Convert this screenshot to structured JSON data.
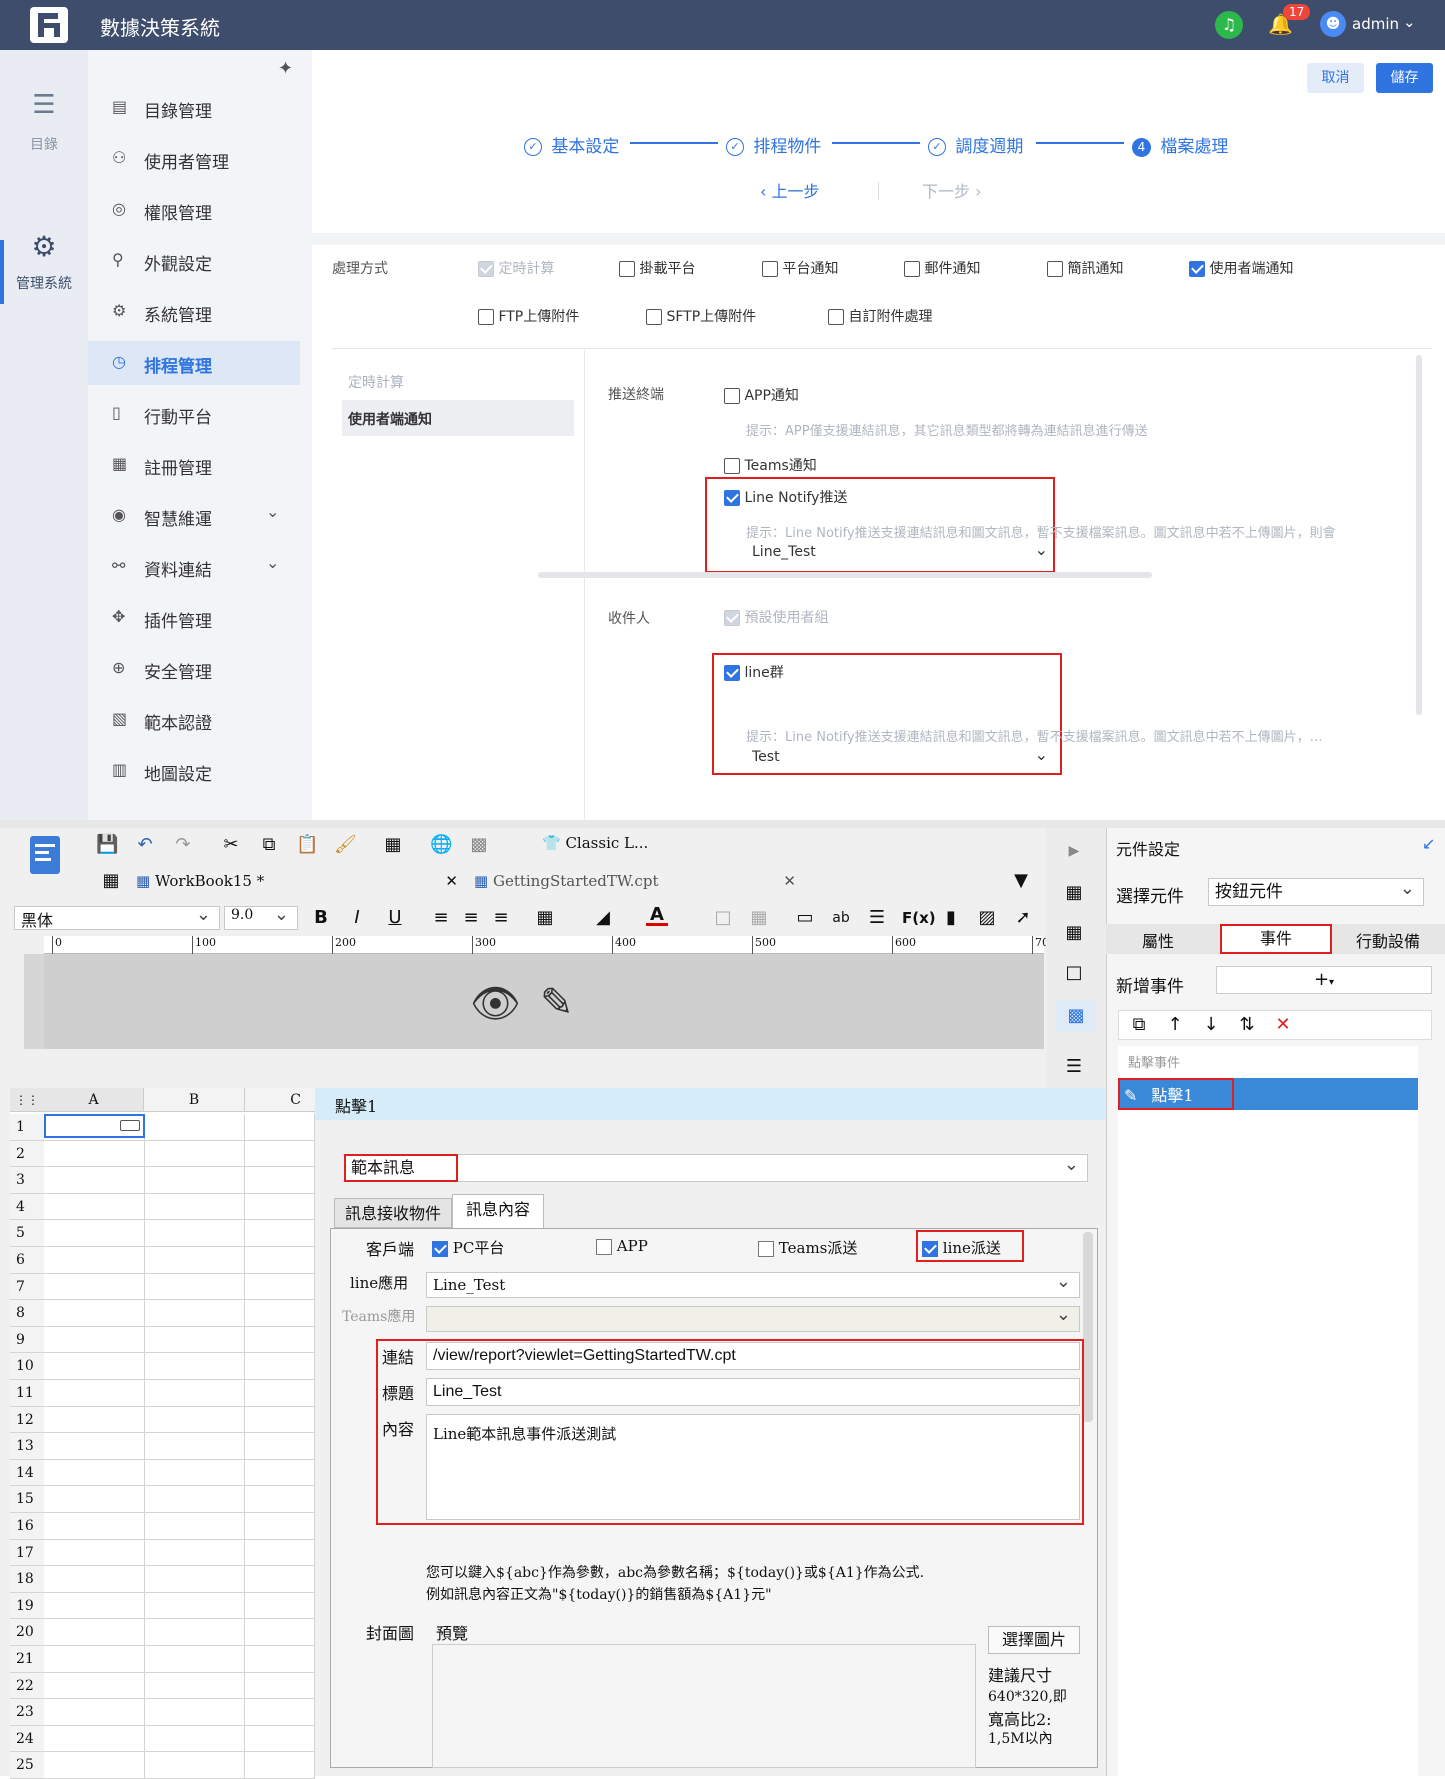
{
  "app": {
    "title": "數據決策系統",
    "notifications": "17",
    "user": "admin"
  },
  "rail": [
    {
      "label": "目錄",
      "icon": "list-icon"
    },
    {
      "label": "管理系統",
      "icon": "gear-icon"
    }
  ],
  "menu": [
    {
      "label": "目錄管理",
      "icon": "catalog-icon"
    },
    {
      "label": "使用者管理",
      "icon": "user-icon"
    },
    {
      "label": "權限管理",
      "icon": "permission-icon"
    },
    {
      "label": "外觀設定",
      "icon": "brush-icon"
    },
    {
      "label": "系統管理",
      "icon": "gear-icon"
    },
    {
      "label": "排程管理",
      "icon": "clock-icon",
      "active": true
    },
    {
      "label": "行動平台",
      "icon": "mobile-icon"
    },
    {
      "label": "註冊管理",
      "icon": "register-icon"
    },
    {
      "label": "智慧維運",
      "icon": "ops-icon",
      "expandable": true
    },
    {
      "label": "資料連結",
      "icon": "link-icon",
      "expandable": true
    },
    {
      "label": "插件管理",
      "icon": "plugin-icon"
    },
    {
      "label": "安全管理",
      "icon": "shield-icon"
    },
    {
      "label": "範本認證",
      "icon": "template-icon"
    },
    {
      "label": "地圖設定",
      "icon": "map-icon"
    }
  ],
  "actions": {
    "cancel": "取消",
    "save": "儲存"
  },
  "steps": [
    {
      "label": "基本設定",
      "state": "done"
    },
    {
      "label": "排程物件",
      "state": "done"
    },
    {
      "label": "調度週期",
      "state": "done"
    },
    {
      "label": "檔案處理",
      "state": "current",
      "num": "4"
    }
  ],
  "nav": {
    "prev": "上一步",
    "next": "下一步"
  },
  "processing": {
    "label": "處理方式",
    "options": [
      {
        "label": "定時計算",
        "state": "disabled"
      },
      {
        "label": "掛載平台",
        "state": "off"
      },
      {
        "label": "平台通知",
        "state": "off"
      },
      {
        "label": "郵件通知",
        "state": "off"
      },
      {
        "label": "簡訊通知",
        "state": "off"
      },
      {
        "label": "使用者端通知",
        "state": "on"
      },
      {
        "label": "FTP上傳附件",
        "state": "off"
      },
      {
        "label": "SFTP上傳附件",
        "state": "off"
      },
      {
        "label": "自訂附件處理",
        "state": "off"
      }
    ]
  },
  "subnav": [
    {
      "label": "定時計算"
    },
    {
      "label": "使用者端通知"
    }
  ],
  "push": {
    "label": "推送終端",
    "app": "APP通知",
    "app_hint": "提示：APP僅支援連結訊息，其它訊息類型都將轉為連結訊息進行傳送",
    "teams": "Teams通知",
    "line": "Line Notify推送",
    "line_hint": "提示：Line Notify推送支援連結訊息和圖文訊息，暫不支援檔案訊息。圖文訊息中若不上傳圖片，則會",
    "line_select": "Line_Test"
  },
  "recipient": {
    "label": "收件人",
    "default": "預設使用者組",
    "group": "line群",
    "hint": "提示：Line Notify推送支援連結訊息和圖文訊息，暫不支援檔案訊息。圖文訊息中若不上傳圖片，…",
    "select": "Test"
  },
  "designer": {
    "template_name": "Classic L...",
    "tabs": [
      {
        "label": "WorkBook15 *"
      },
      {
        "label": "GettingStartedTW.cpt"
      }
    ],
    "font": "黑体",
    "size": "9.0",
    "ruler": [
      "0",
      "100",
      "200",
      "300",
      "400",
      "500",
      "600",
      "70"
    ],
    "cols": [
      "A",
      "B",
      "C"
    ],
    "rows": [
      "1",
      "2",
      "3",
      "4",
      "5",
      "6",
      "7",
      "8",
      "9",
      "10",
      "11",
      "12",
      "13",
      "14",
      "15",
      "16",
      "17",
      "18",
      "19",
      "20",
      "21",
      "22",
      "23",
      "24",
      "25"
    ],
    "event_title": "點擊1",
    "event_type": "範本訊息",
    "event_tabs": [
      "訊息接收物件",
      "訊息內容"
    ],
    "client_label": "客戶端",
    "clients": [
      {
        "label": "PC平台",
        "state": "on"
      },
      {
        "label": "APP",
        "state": "off"
      },
      {
        "label": "Teams派送",
        "state": "off"
      },
      {
        "label": "line派送",
        "state": "on"
      }
    ],
    "line_app_label": "line應用",
    "line_app": "Line_Test",
    "teams_app_label": "Teams應用",
    "link_label": "連結",
    "link": "/view/report?viewlet=GettingStartedTW.cpt",
    "title_label": "標題",
    "title": "Line_Test",
    "content_label": "內容",
    "content": "Line範本訊息事件派送測試",
    "note1": "您可以鍵入${abc}作為參數，abc為參數名稱；${today()}或${A1}作為公式.",
    "note2": "例如訊息內容正文為\"${today()}的銷售額為${A1}元\"",
    "cover_label": "封面圖",
    "preview": "預覽",
    "choose_image": "選擇圖片",
    "suggest": "建議尺寸",
    "suggest_size": "640*320,即",
    "suggest_ratio": "寬高比2:",
    "suggest_max": "1,5M以內",
    "panel_title": "元件設定",
    "select_label": "選擇元件",
    "select_value": "按鈕元件",
    "panel_tabs": [
      "屬性",
      "事件",
      "行動設備"
    ],
    "add_event": "新增事件",
    "event_group": "點擊事件",
    "event_item": "點擊1"
  }
}
